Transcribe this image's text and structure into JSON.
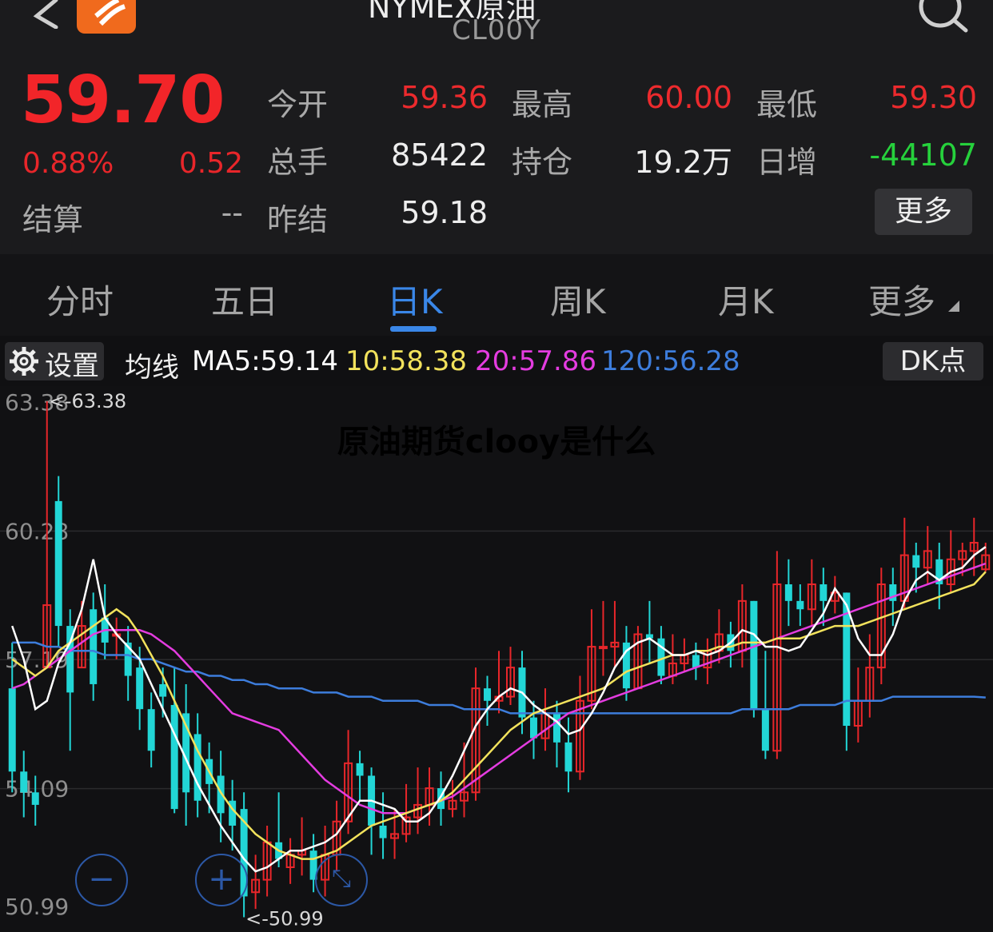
{
  "header": {
    "title": "NYMEX原油",
    "symbol": "CL00Y"
  },
  "quote": {
    "price": "59.70",
    "change_pct": "0.88%",
    "change": "0.52",
    "fields": [
      {
        "label": "今开",
        "value": "59.36",
        "color": "red"
      },
      {
        "label": "最高",
        "value": "60.00",
        "color": "red"
      },
      {
        "label": "最低",
        "value": "59.30",
        "color": "red"
      },
      {
        "label": "总手",
        "value": "85422",
        "color": "white"
      },
      {
        "label": "持仓",
        "value": "19.2万",
        "color": "white"
      },
      {
        "label": "日增",
        "value": "-44107",
        "color": "green"
      },
      {
        "label": "结算",
        "value": "--",
        "color": "white"
      },
      {
        "label": "昨结",
        "value": "59.18",
        "color": "white"
      }
    ],
    "more_label": "更多"
  },
  "tabs": [
    "分时",
    "五日",
    "日K",
    "周K",
    "月K",
    "更多"
  ],
  "active_tab": "日K",
  "ma_bar": {
    "settings_label": "设置",
    "ma_label": "均线",
    "ma5": "MA5:59.14",
    "ma10": "10:58.38",
    "ma20": "20:57.86",
    "ma120": "120:56.28",
    "dk_label": "DK点"
  },
  "watermark": "原油期货clooy是什么",
  "colors": {
    "up": "#e8262a",
    "down": "#22d6d6",
    "ma5": "#ffffff",
    "ma10": "#f2e25c",
    "ma20": "#e43ce0",
    "ma120": "#3d7ddc",
    "accent": "#3a87e8"
  },
  "chart_data": {
    "type": "candlestick",
    "y_ticks": [
      "63.38",
      "60.28",
      "57.19",
      "54.09",
      "50.99"
    ],
    "ylim": [
      50.99,
      63.38
    ],
    "annotations": {
      "max": "<-63.38",
      "min": "<-50.99"
    },
    "candles": [
      [
        56.5,
        54.5,
        57.6,
        54.0
      ],
      [
        54.5,
        54.0,
        55.0,
        53.4
      ],
      [
        54.0,
        53.7,
        54.4,
        53.2
      ],
      [
        57.0,
        58.5,
        63.4,
        57.0
      ],
      [
        61.0,
        58.0,
        61.6,
        57.5
      ],
      [
        58.0,
        56.4,
        58.4,
        55.0
      ],
      [
        57.0,
        58.0,
        58.6,
        57.0
      ],
      [
        58.4,
        56.6,
        58.8,
        56.2
      ],
      [
        58.2,
        57.6,
        59.0,
        57.2
      ],
      [
        57.8,
        57.8,
        58.2,
        57.2
      ],
      [
        57.6,
        56.8,
        58.0,
        56.2
      ],
      [
        57.0,
        56.0,
        57.5,
        55.5
      ],
      [
        56.0,
        55.0,
        56.4,
        54.6
      ],
      [
        56.6,
        56.3,
        57.0,
        55.8
      ],
      [
        56.1,
        53.6,
        57.0,
        53.5
      ],
      [
        55.9,
        54.0,
        56.6,
        53.2
      ],
      [
        55.4,
        53.8,
        55.9,
        53.4
      ],
      [
        54.8,
        54.2,
        55.2,
        53.5
      ],
      [
        54.4,
        53.5,
        55.0,
        52.8
      ],
      [
        53.8,
        53.2,
        54.3,
        52.6
      ],
      [
        53.6,
        51.5,
        54.0,
        51.0
      ],
      [
        51.6,
        51.9,
        52.5,
        51.2
      ],
      [
        51.9,
        52.8,
        53.2,
        51.5
      ],
      [
        52.8,
        52.4,
        54.0,
        52.2
      ],
      [
        52.2,
        52.5,
        52.9,
        51.8
      ],
      [
        52.5,
        52.6,
        53.4,
        52.0
      ],
      [
        52.6,
        51.9,
        53.0,
        51.6
      ],
      [
        51.9,
        52.5,
        53.2,
        51.5
      ],
      [
        52.5,
        53.3,
        53.8,
        52.1
      ],
      [
        53.3,
        54.7,
        55.5,
        53.0
      ],
      [
        54.7,
        54.4,
        55.0,
        53.8
      ],
      [
        54.4,
        53.2,
        54.6,
        52.5
      ],
      [
        53.2,
        52.9,
        54.0,
        52.4
      ],
      [
        52.9,
        53.0,
        53.6,
        52.4
      ],
      [
        53.0,
        53.4,
        54.2,
        52.8
      ],
      [
        53.4,
        53.7,
        54.6,
        53.0
      ],
      [
        53.7,
        54.1,
        54.6,
        53.2
      ],
      [
        54.1,
        53.6,
        54.5,
        53.2
      ],
      [
        53.6,
        53.8,
        54.3,
        53.4
      ],
      [
        53.8,
        54.0,
        55.2,
        53.4
      ],
      [
        54.0,
        56.5,
        57.0,
        53.8
      ],
      [
        56.5,
        56.2,
        56.8,
        55.6
      ],
      [
        56.2,
        56.3,
        57.4,
        55.9
      ],
      [
        56.3,
        57.0,
        57.5,
        56.1
      ],
      [
        57.0,
        55.8,
        57.4,
        55.4
      ],
      [
        55.8,
        55.3,
        56.2,
        54.8
      ],
      [
        55.3,
        55.9,
        56.5,
        55.0
      ],
      [
        55.9,
        55.2,
        56.2,
        54.6
      ],
      [
        55.2,
        54.5,
        55.8,
        54.0
      ],
      [
        54.5,
        56.2,
        56.8,
        54.3
      ],
      [
        56.2,
        57.5,
        58.4,
        56.0
      ],
      [
        57.5,
        57.5,
        58.6,
        56.8
      ],
      [
        57.5,
        57.6,
        58.6,
        57.0
      ],
      [
        57.6,
        56.5,
        58.0,
        56.2
      ],
      [
        56.5,
        57.8,
        58.0,
        56.5
      ],
      [
        57.8,
        57.7,
        58.6,
        57.1
      ],
      [
        57.7,
        56.8,
        58.0,
        56.6
      ],
      [
        56.8,
        57.1,
        57.8,
        56.6
      ],
      [
        57.1,
        57.3,
        57.7,
        56.9
      ],
      [
        57.3,
        57.0,
        57.6,
        56.7
      ],
      [
        57.0,
        57.4,
        57.7,
        56.6
      ],
      [
        57.4,
        57.8,
        58.4,
        57.1
      ],
      [
        57.8,
        57.4,
        58.1,
        57.0
      ],
      [
        57.4,
        58.6,
        59.0,
        57.0
      ],
      [
        58.6,
        56.0,
        58.6,
        55.8
      ],
      [
        56.0,
        55.0,
        57.4,
        54.8
      ],
      [
        55.0,
        59.0,
        59.8,
        54.8
      ],
      [
        59.0,
        58.6,
        59.6,
        58.0
      ],
      [
        58.6,
        58.4,
        59.0,
        58.0
      ],
      [
        58.4,
        59.0,
        59.6,
        58.0
      ],
      [
        59.0,
        58.6,
        59.4,
        58.0
      ],
      [
        58.6,
        58.8,
        59.2,
        58.3
      ],
      [
        58.8,
        55.6,
        58.8,
        55.0
      ],
      [
        55.6,
        56.2,
        57.0,
        55.2
      ],
      [
        56.2,
        57.0,
        57.8,
        55.8
      ],
      [
        57.0,
        59.0,
        59.4,
        56.6
      ],
      [
        59.0,
        58.6,
        59.4,
        58.0
      ],
      [
        58.6,
        59.7,
        60.6,
        58.4
      ],
      [
        59.7,
        59.4,
        60.0,
        58.8
      ],
      [
        59.4,
        59.8,
        60.4,
        59.0
      ],
      [
        59.6,
        59.0,
        60.0,
        58.4
      ],
      [
        59.0,
        59.6,
        60.3,
        58.8
      ],
      [
        59.6,
        59.8,
        60.0,
        59.2
      ],
      [
        59.8,
        60.0,
        60.6,
        59.2
      ],
      [
        59.36,
        59.7,
        60.0,
        59.3
      ]
    ],
    "ma5": [
      58.0,
      57.2,
      56.0,
      56.2,
      57.1,
      57.6,
      58.4,
      59.6,
      58.2,
      57.8,
      57.5,
      57.2,
      56.6,
      56.0,
      55.4,
      54.8,
      54.2,
      53.7,
      53.2,
      52.8,
      52.4,
      52.1,
      52.2,
      52.4,
      52.6,
      52.6,
      52.7,
      52.8,
      53.0,
      53.4,
      53.8,
      53.8,
      53.7,
      53.6,
      53.3,
      53.3,
      53.5,
      53.9,
      54.4,
      55.0,
      55.6,
      56.0,
      56.3,
      56.5,
      56.4,
      56.1,
      55.9,
      55.7,
      55.4,
      55.5,
      55.9,
      56.4,
      57.0,
      57.4,
      57.6,
      57.7,
      57.5,
      57.3,
      57.3,
      57.4,
      57.3,
      57.4,
      57.6,
      57.9,
      57.8,
      57.5,
      57.5,
      57.4,
      57.5,
      57.9,
      58.3,
      58.9,
      58.5,
      57.7,
      57.3,
      57.3,
      57.8,
      58.6,
      59.1,
      59.3,
      59.1,
      59.3,
      59.4,
      59.7,
      59.9
    ],
    "ma10": [
      57.2,
      57.0,
      56.8,
      57.0,
      57.4,
      57.6,
      57.8,
      58.0,
      58.2,
      58.4,
      58.2,
      57.8,
      57.3,
      56.8,
      56.2,
      55.6,
      55.0,
      54.5,
      54.0,
      53.6,
      53.3,
      53.0,
      52.8,
      52.6,
      52.5,
      52.4,
      52.4,
      52.5,
      52.6,
      52.8,
      53.0,
      53.2,
      53.3,
      53.4,
      53.5,
      53.6,
      53.7,
      53.8,
      54.0,
      54.3,
      54.6,
      54.9,
      55.2,
      55.5,
      55.7,
      55.9,
      56.0,
      56.1,
      56.2,
      56.3,
      56.4,
      56.5,
      56.7,
      56.9,
      57.0,
      57.1,
      57.2,
      57.3,
      57.3,
      57.4,
      57.4,
      57.5,
      57.5,
      57.6,
      57.6,
      57.6,
      57.7,
      57.7,
      57.7,
      57.8,
      57.9,
      58.0,
      58.0,
      58.0,
      58.1,
      58.2,
      58.3,
      58.4,
      58.5,
      58.6,
      58.7,
      58.8,
      58.9,
      59.0,
      59.3
    ],
    "ma20": [
      56.5,
      56.6,
      56.8,
      57.0,
      57.2,
      57.4,
      57.6,
      57.8,
      57.9,
      57.9,
      57.9,
      57.9,
      57.8,
      57.6,
      57.4,
      57.1,
      56.8,
      56.5,
      56.2,
      55.9,
      55.8,
      55.7,
      55.6,
      55.5,
      55.2,
      54.9,
      54.6,
      54.3,
      54.1,
      53.9,
      53.7,
      53.6,
      53.5,
      53.5,
      53.5,
      53.6,
      53.7,
      53.8,
      53.9,
      54.1,
      54.3,
      54.5,
      54.7,
      54.9,
      55.1,
      55.3,
      55.5,
      55.7,
      55.9,
      56.0,
      56.1,
      56.2,
      56.3,
      56.4,
      56.5,
      56.6,
      56.7,
      56.8,
      56.9,
      57.0,
      57.1,
      57.2,
      57.3,
      57.4,
      57.5,
      57.6,
      57.7,
      57.8,
      57.9,
      58.0,
      58.1,
      58.2,
      58.3,
      58.4,
      58.5,
      58.6,
      58.7,
      58.8,
      58.9,
      59.0,
      59.1,
      59.2,
      59.3,
      59.4,
      59.5
    ],
    "ma120": [
      57.6,
      57.6,
      57.6,
      57.5,
      57.5,
      57.4,
      57.4,
      57.4,
      57.3,
      57.3,
      57.3,
      57.2,
      57.2,
      57.1,
      57.0,
      56.9,
      56.9,
      56.8,
      56.8,
      56.7,
      56.7,
      56.6,
      56.6,
      56.5,
      56.5,
      56.5,
      56.4,
      56.4,
      56.4,
      56.3,
      56.3,
      56.3,
      56.2,
      56.2,
      56.2,
      56.2,
      56.1,
      56.1,
      56.1,
      56.0,
      56.0,
      56.0,
      56.0,
      55.9,
      55.9,
      55.9,
      55.9,
      55.9,
      55.9,
      55.9,
      55.9,
      55.9,
      55.9,
      55.9,
      55.9,
      55.9,
      55.9,
      55.9,
      55.9,
      55.9,
      55.9,
      55.9,
      55.9,
      56.0,
      56.0,
      56.0,
      56.0,
      56.0,
      56.1,
      56.1,
      56.1,
      56.1,
      56.2,
      56.2,
      56.2,
      56.2,
      56.3,
      56.3,
      56.3,
      56.3,
      56.3,
      56.3,
      56.3,
      56.3,
      56.28
    ]
  }
}
